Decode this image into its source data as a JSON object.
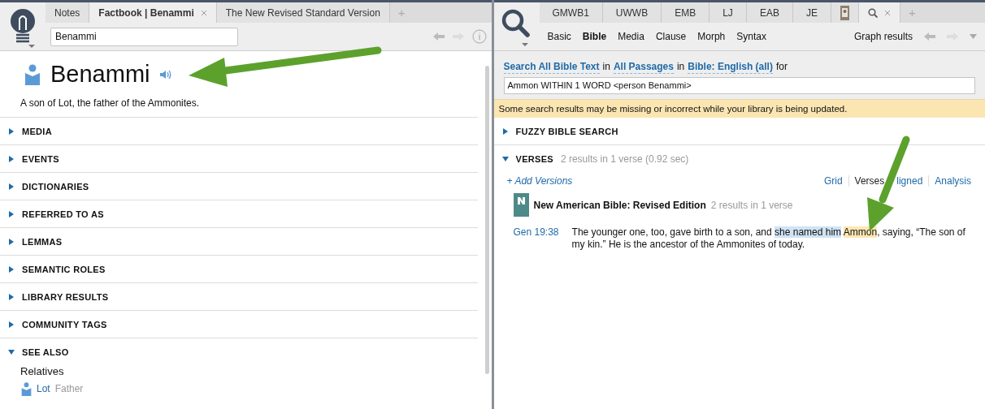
{
  "left": {
    "tabs": [
      {
        "label": "Notes",
        "selected": false,
        "closable": false
      },
      {
        "label": "Factbook | Benammi",
        "selected": true,
        "closable": true
      },
      {
        "label": "The New Revised Standard Version",
        "selected": false,
        "closable": false
      }
    ],
    "new_tab": "+",
    "search_value": "Benammi",
    "title": "Benammi",
    "description": "A son of Lot, the father of the Ammonites.",
    "sections": [
      {
        "label": "MEDIA",
        "expanded": false
      },
      {
        "label": "EVENTS",
        "expanded": false
      },
      {
        "label": "DICTIONARIES",
        "expanded": false
      },
      {
        "label": "REFERRED TO AS",
        "expanded": false
      },
      {
        "label": "LEMMAS",
        "expanded": false
      },
      {
        "label": "SEMANTIC ROLES",
        "expanded": false
      },
      {
        "label": "LIBRARY RESULTS",
        "expanded": false
      },
      {
        "label": "COMMUNITY TAGS",
        "expanded": false
      },
      {
        "label": "SEE ALSO",
        "expanded": true,
        "heading": "Relatives",
        "items": [
          {
            "name": "Lot",
            "role": "Father"
          }
        ]
      }
    ]
  },
  "right": {
    "tabs": [
      {
        "kind": "text",
        "label": "GMWB1",
        "selected": false
      },
      {
        "kind": "text",
        "label": "UWWB",
        "selected": false
      },
      {
        "kind": "text",
        "label": "EMB",
        "selected": false
      },
      {
        "kind": "text",
        "label": "LJ",
        "selected": false
      },
      {
        "kind": "text",
        "label": "EAB",
        "selected": false
      },
      {
        "kind": "text",
        "label": "JE",
        "selected": false
      },
      {
        "kind": "image",
        "selected": false
      },
      {
        "kind": "search",
        "selected": true
      }
    ],
    "new_tab": "+",
    "modes": [
      {
        "label": "Basic",
        "selected": false
      },
      {
        "label": "Bible",
        "selected": true
      },
      {
        "label": "Media",
        "selected": false
      },
      {
        "label": "Clause",
        "selected": false
      },
      {
        "label": "Morph",
        "selected": false
      },
      {
        "label": "Syntax",
        "selected": false
      }
    ],
    "graph_label": "Graph results",
    "criteria": [
      {
        "kind": "link",
        "text": "Search All Bible Text"
      },
      {
        "kind": "word",
        "text": "in"
      },
      {
        "kind": "link",
        "text": "All Passages"
      },
      {
        "kind": "word",
        "text": "in"
      },
      {
        "kind": "link",
        "text": "Bible: English (all)"
      },
      {
        "kind": "word",
        "text": "for"
      }
    ],
    "query": "Ammon  WITHIN 1 WORD <person Benammi>",
    "warning": "Some search results may be missing or incorrect while your library is being updated.",
    "fuzzy": {
      "label": "FUZZY BIBLE SEARCH",
      "expanded": false
    },
    "verses": {
      "label": "VERSES",
      "expanded": true,
      "summary": "2 results in 1 verse (0.92 sec)"
    },
    "add_versions": "+ Add Versions",
    "views": [
      {
        "label": "Grid",
        "selected": false
      },
      {
        "label": "Verses",
        "selected": true
      },
      {
        "label": "ligned",
        "selected": false
      },
      {
        "label": "Analysis",
        "selected": false
      }
    ],
    "version": {
      "title": "New American Bible: Revised Edition",
      "summary": "2 results in 1 verse"
    },
    "results": [
      {
        "ref": "Gen 19:38",
        "segments": [
          {
            "kind": "plain",
            "text": "The younger one, too, gave birth to a son, and "
          },
          {
            "kind": "term",
            "text": "she named him"
          },
          {
            "kind": "match",
            "text": "Ammon"
          },
          {
            "kind": "plain",
            "text": ", saying, “The son of my kin.” He is the ancestor of the Ammonites of today."
          }
        ]
      }
    ]
  }
}
